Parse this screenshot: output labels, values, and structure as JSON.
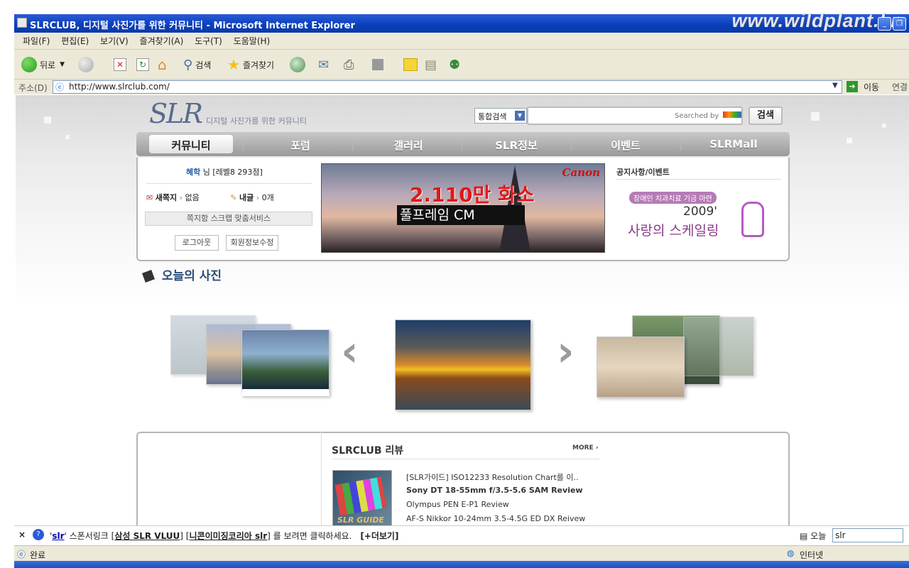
{
  "window": {
    "title": "SLRCLUB, 디지털 사진가를 위한 커뮤니티 - Microsoft Internet Explorer",
    "watermark": "www.wildplant.kr"
  },
  "menubar": {
    "items": [
      "파일(F)",
      "편집(E)",
      "보기(V)",
      "즐겨찾기(A)",
      "도구(T)",
      "도움말(H)"
    ]
  },
  "toolbar": {
    "back": "뒤로",
    "search": "검색",
    "favorites": "즐겨찾기"
  },
  "address": {
    "label": "주소(D)",
    "url": "http://www.slrclub.com/",
    "go": "이동",
    "links": "연결"
  },
  "site": {
    "logo": "SLR",
    "tagline": "디지털 사진가를 위한 커뮤니티",
    "search_select": "통합검색",
    "searched_by": "Searched by",
    "search_button": "검색",
    "nav": [
      "커뮤니티",
      "포럼",
      "갤러리",
      "SLR정보",
      "이벤트",
      "SLRMall"
    ]
  },
  "user": {
    "name": "혜학",
    "rest": "님 [레벨8  293점]",
    "message_label": "새쪽지",
    "message_value": "없음",
    "posts_label": "내글",
    "posts_value": "0개",
    "links": "쪽지함   스크랩   맞춤서비스",
    "logout": "로그아웃",
    "edit_info": "회원정보수정"
  },
  "banner": {
    "brand": "Canon",
    "headline": "2.110만 화소",
    "subline": "풀프레임 CM"
  },
  "notice": {
    "title": "공지사항/이벤트",
    "badge": "장애인 치과치료 기금 마련",
    "year": "2009'",
    "main": "사랑의 스케일링"
  },
  "today_photo": {
    "title": "오늘의 사진"
  },
  "review": {
    "title": "SLRCLUB 리뷰",
    "more": "MORE ›",
    "thumb_label": "SLR GUIDE",
    "items": [
      "[SLR가이드] ISO12233 Resolution Chart를 이..",
      "Sony DT 18-55mm f/3.5-5.6 SAM Review",
      "Olympus PEN E-P1 Review",
      "AF-S Nikkor 10-24mm 3.5-4.5G ED DX Reivew"
    ]
  },
  "infobar": {
    "close": "×",
    "keyword": "slr",
    "text1": "스폰서링크",
    "link1": "삼성 SLR VLUU",
    "link2": "니콘이미징코리아 slr",
    "text2": "를 보려면 클릭하세요.",
    "more": "[+더보기]",
    "today": "오늘",
    "query": "slr"
  },
  "status": {
    "done": "완료",
    "zone": "인터넷"
  }
}
